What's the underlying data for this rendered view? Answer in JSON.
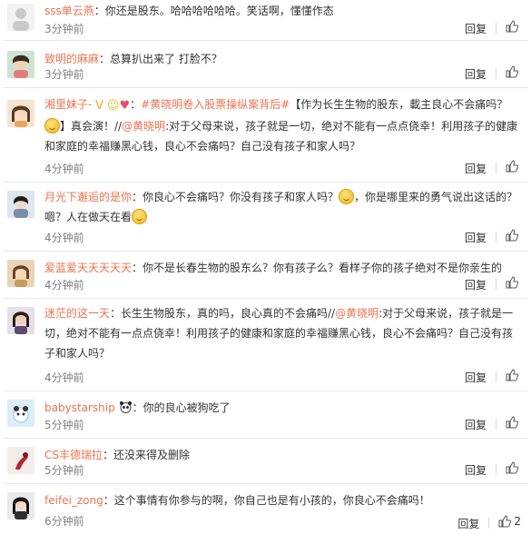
{
  "comments": [
    {
      "user": "sss单云燕",
      "text": "：你还是股东。哈哈哈哈哈哈。笑话啊，懂懂作态",
      "time": "3分钟前",
      "likes": ""
    },
    {
      "user": "致明的麻麻",
      "text": "：总算扒出来了 打脸不？",
      "time": "3分钟前",
      "likes": ""
    },
    {
      "user": "湘里妹子-",
      "badges": "V ☺ ♥",
      "topic": "#黄晓明卷入股票操纵案背后#",
      "pre": "【作为长生生物的股东，載主良心不会痛吗？",
      "post": "】真会演！",
      "mention_intro": "//",
      "mention": "@黄晓明",
      "mention_text": ":对于父母来说，孩子就是一切，绝对不能有一点点侥幸！利用孩子的健康和家庭的幸福赚黑心钱，良心不会痛吗？自己没有孩子和家人吗？",
      "time": "4分钟前",
      "likes": ""
    },
    {
      "user": "月光下邂逅的是你",
      "text1": "：你良心不会痛吗？你没有孩子和家人吗？",
      "text2": "，你是哪里来的勇气说出这话的？嗯？人在做天在看",
      "time": "4分钟前",
      "likes": ""
    },
    {
      "user": "爱蓝爱天天天天天",
      "text": "：你不是长春生物的股东么？你有孩子么？看样子你的孩子绝对不是你亲生的",
      "time": "4分钟前",
      "likes": ""
    },
    {
      "user": "迷茫的这一天",
      "text": "：长生生物股东，真的吗，良心真的不会痛吗//",
      "mention": "@黄晓明",
      "mention_text": ":对于父母来说，孩子就是一切，绝对不能有一点点侥幸！利用孩子的健康和家庭的幸福赚黑心钱，良心不会痛吗？自己没有孩子和家人吗？",
      "time": "4分钟前",
      "likes": ""
    },
    {
      "user": "babystarship",
      "icon": "panda-icon",
      "text": "：你的良心被狗吃了",
      "time": "5分钟前",
      "likes": ""
    },
    {
      "user": "CS丰德瑞拉",
      "text": "：还没来得及删除",
      "time": "5分钟前",
      "likes": ""
    },
    {
      "user": "feifei_zong",
      "text": "：这个事情有你参与的啊，你自己也是有小孩的，你良心不会痛吗！",
      "time": "6分钟前",
      "likes": "2"
    }
  ],
  "ui": {
    "reply_label": "回复",
    "like_icon": "thumb-up-icon",
    "accent": "#eb7350"
  }
}
